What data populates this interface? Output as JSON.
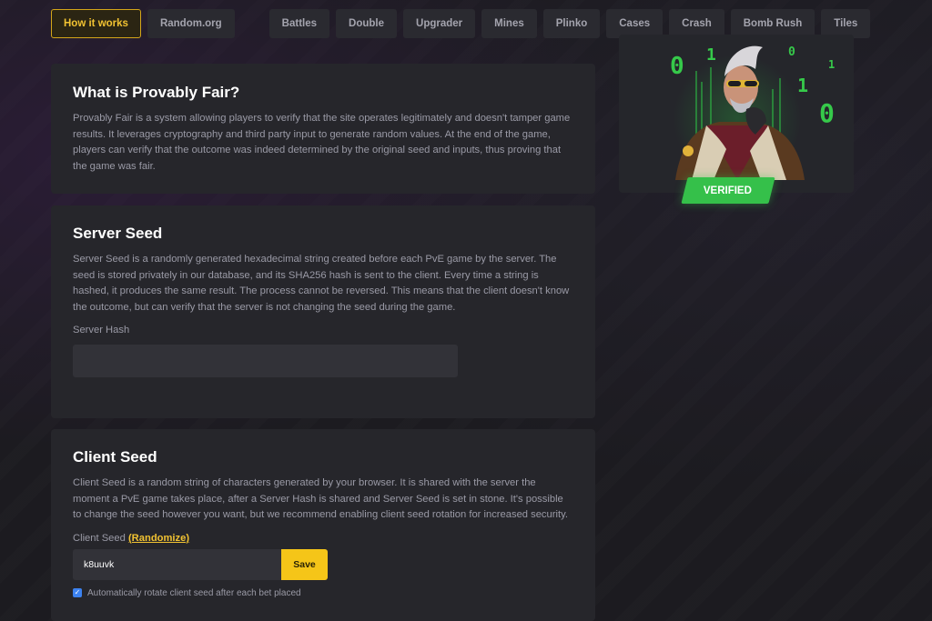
{
  "nav": {
    "tabs": [
      "How it works",
      "Random.org",
      "Battles",
      "Double",
      "Upgrader",
      "Mines",
      "Plinko",
      "Cases",
      "Crash",
      "Bomb Rush",
      "Tiles"
    ],
    "active": "How it works"
  },
  "provably_fair": {
    "title": "What is Provably Fair?",
    "body": "Provably Fair is a system allowing players to verify that the site operates legitimately and doesn't tamper game results. It leverages cryptography and third party input to generate random values. At the end of the game, players can verify that the outcome was indeed determined by the original seed and inputs, thus proving that the game was fair."
  },
  "server_seed": {
    "title": "Server Seed",
    "body": "Server Seed is a randomly generated hexadecimal string created before each PvE game by the server. The seed is stored privately in our database, and its SHA256 hash is sent to the client. Every time a string is hashed, it produces the same result. The process cannot be reversed. This means that the client doesn't know the outcome, but can verify that the server is not changing the seed during the game.",
    "hash_label": "Server Hash",
    "hash_value": ""
  },
  "client_seed": {
    "title": "Client Seed",
    "body": "Client Seed is a random string of characters generated by your browser. It is shared with the server the moment a PvE game takes place, after a Server Hash is shared and Server Seed is set in stone. It's possible to change the seed however you want, but we recommend enabling client seed rotation for increased security.",
    "label": "Client Seed",
    "randomize_label": "(Randomize)",
    "value": "k8uuvk",
    "save_label": "Save",
    "auto_rotate_label": "Automatically rotate client seed after each bet placed",
    "auto_rotate_checked": true
  },
  "hero": {
    "badge": "VERIFIED",
    "matrix_digits": [
      "0",
      "1",
      "0",
      "1",
      "1",
      "0"
    ],
    "accent": "#35c04a"
  },
  "colors": {
    "accent_gold": "#f5c518",
    "card_bg": "#26262b",
    "page_bg": "#1c1b20"
  }
}
